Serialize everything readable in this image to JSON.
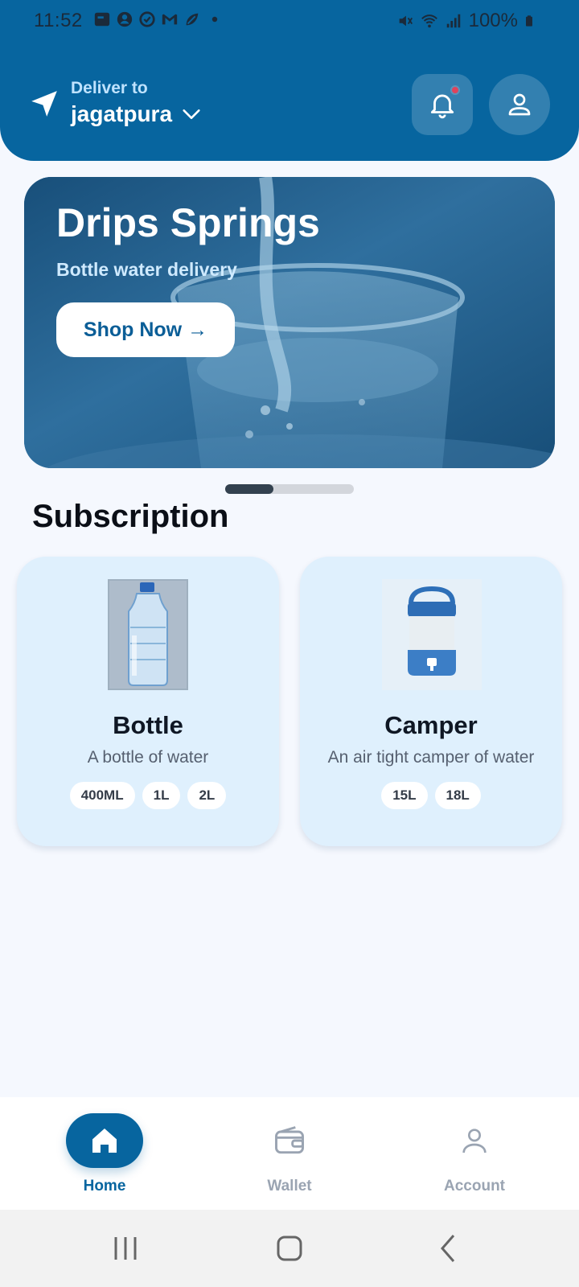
{
  "status_bar": {
    "time": "11:52",
    "battery": "100%"
  },
  "header": {
    "deliver_label": "Deliver to",
    "location": "jagatpura"
  },
  "banner": {
    "title": "Drips Springs",
    "subtitle": "Bottle water delivery",
    "cta_label": "Shop Now →"
  },
  "carousel": {
    "active_index": 0,
    "total": 2
  },
  "section": {
    "title": "Subscription"
  },
  "products": [
    {
      "name": "Bottle",
      "description": "A bottle of water",
      "sizes": [
        "400ML",
        "1L",
        "2L"
      ],
      "image_icon": "water-bottle"
    },
    {
      "name": "Camper",
      "description": "An air tight camper of water",
      "sizes": [
        "15L",
        "18L"
      ],
      "image_icon": "water-camper"
    }
  ],
  "bottom_nav": {
    "items": [
      {
        "label": "Home",
        "icon": "home-icon",
        "active": true
      },
      {
        "label": "Wallet",
        "icon": "wallet-icon",
        "active": false
      },
      {
        "label": "Account",
        "icon": "user-icon",
        "active": false
      }
    ]
  },
  "colors": {
    "primary": "#07659f",
    "card_bg": "#dff0fd",
    "page_bg": "#f5f8fe",
    "notification_dot": "#e0435c"
  }
}
